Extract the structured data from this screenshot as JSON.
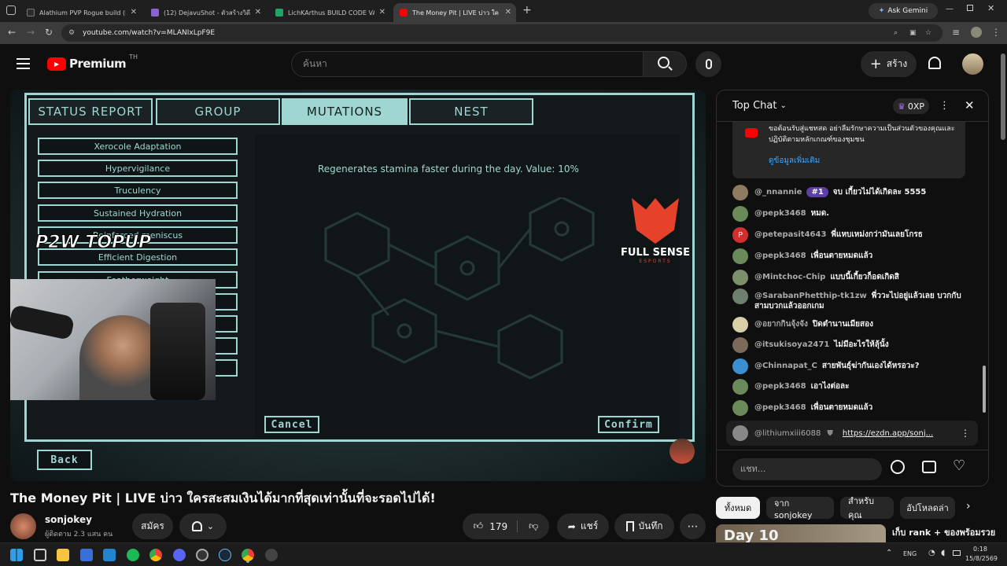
{
  "browser": {
    "tabs": [
      {
        "title": "Alathium PVP Rogue build (Ran",
        "color": "#2d2d2d"
      },
      {
        "title": "(12) DejavuShot - ตัวสร้างวิดีโอ -",
        "color": "#8a63d2"
      },
      {
        "title": "LichKArthus BUILD CODE VAUL",
        "color": "#1fa463"
      },
      {
        "title": "The Money Pit | LIVE บ่าว ใครสะสม",
        "color": "#ff0000"
      }
    ],
    "ask_gemini": "Ask Gemini",
    "url": "youtube.com/watch?v=MLANIxLpF9E"
  },
  "header": {
    "logo_text": "Premium",
    "logo_sup": "TH",
    "search_placeholder": "ค้นหา",
    "create_label": "สร้าง"
  },
  "game": {
    "tabs": [
      "STATUS REPORT",
      "GROUP",
      "MUTATIONS",
      "NEST"
    ],
    "active_tab": "MUTATIONS",
    "mutations": [
      "Xerocole Adaptation",
      "Hypervigilance",
      "Truculency",
      "Sustained Hydration",
      "Reinforced meniscus",
      "Efficient Digestion",
      "Featherweight",
      "",
      "",
      "",
      ""
    ],
    "description": "Regenerates stamina faster during the day. Value: 10%",
    "cancel": "Cancel",
    "confirm": "Confirm",
    "back": "Back",
    "sponsor_logo": "FULL SENSE",
    "sponsor_sub": "ESPORTS",
    "topup_logo": "P2W TOPUP"
  },
  "chat": {
    "header": "Top Chat",
    "xp": "0XP",
    "notice": "ขอต้อนรับสู่แชทสด อย่าลืมรักษาความเป็นส่วนตัวของคุณและปฏิบัติตามหลักเกณฑ์ของชุมชน",
    "notice_link": "ดูข้อมูลเพิ่มเติม",
    "messages": [
      {
        "author": "@_nnannie",
        "badge": "#1",
        "text": "จบ เกี้ยวไม่ได้เกิดละ 5555",
        "color": "#8d7a5f"
      },
      {
        "author": "@pepk3468",
        "badge": "",
        "text": "หมด.",
        "color": "#6b8a5a"
      },
      {
        "author": "@petepasit4643",
        "badge": "",
        "text": "พี่แหบเหม่งกว่ามันเลยโกรธ",
        "color": "#d32f2f",
        "initial": "P"
      },
      {
        "author": "@pepk3468",
        "badge": "",
        "text": "เพื่อนตายหมดแล้ว",
        "color": "#6b8a5a"
      },
      {
        "author": "@Mintchoc-Chip",
        "badge": "",
        "text": "แบบนี้เกี้ยวก็อดเกิดสิ",
        "color": "#7a8f6a"
      },
      {
        "author": "@SarabanPhetthip-tk1zw",
        "badge": "",
        "text": "พี่ววะไปอยู่แล้วเลย บวกกับสามบวกแล้วออกเกม",
        "color": "#6d7f6e"
      },
      {
        "author": "@อยากกินจุ้งจัง",
        "badge": "",
        "text": "ปิดตำนานเมียสอง",
        "color": "#d8cfa8"
      },
      {
        "author": "@itsukisoya2471",
        "badge": "",
        "text": "ไม่มีอะไรให้ลุ้นั้ง",
        "color": "#7b6a5a"
      },
      {
        "author": "@Chinnapat_C",
        "badge": "",
        "text": "สายพันธุ์ฆ่ากันเองได้หรอวะ?",
        "color": "#3b8fd0"
      },
      {
        "author": "@pepk3468",
        "badge": "",
        "text": "เอาไงต่อละ",
        "color": "#6b8a5a"
      },
      {
        "author": "@pepk3468",
        "badge": "",
        "text": "เพื่อนตายหมดแล้ว",
        "color": "#6b8a5a"
      }
    ],
    "pinned_author": "@lithiumxiii6088",
    "pinned_link": "https://ezdn.app/sonj...",
    "input_placeholder": "แชท..."
  },
  "video": {
    "title": "The Money Pit | LIVE บ่าว ใครสะสมเงินได้มากที่สุดเท่านั้นที่จะรอดไปได้!",
    "channel": "sonjokey",
    "subscribers": "ผู้ติดตาม 2.3 แสน คน",
    "subscribe": "สมัคร",
    "likes": "179",
    "share": "แชร์",
    "save": "บันทึก"
  },
  "chips": [
    "ทั้งหมด",
    "จาก sonjokey",
    "สำหรับคุณ",
    "อัปโหลดล่า"
  ],
  "reco": {
    "title": "เก็บ rank + ของพร้อมรวย",
    "thumb_text": "Day 10"
  },
  "taskbar": {
    "lang": "ENG",
    "time": "0:18",
    "date": "15/8/2569"
  }
}
